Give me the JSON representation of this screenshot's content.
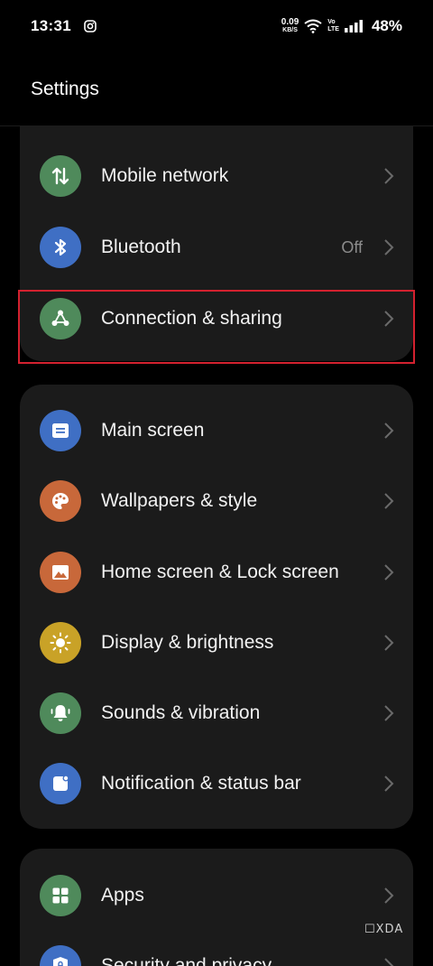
{
  "status_bar": {
    "time": "13:31",
    "speed_value": "0.09",
    "speed_unit": "KB/S",
    "volte_top": "Vo",
    "volte_bottom": "LTE",
    "battery": "48%"
  },
  "header": {
    "title": "Settings"
  },
  "groups": [
    {
      "items": [
        {
          "label": "Mobile network",
          "value": "",
          "icon": "mobile-data-icon",
          "color": "#4f8a5b"
        },
        {
          "label": "Bluetooth",
          "value": "Off",
          "icon": "bluetooth-icon",
          "color": "#3f6fc4"
        },
        {
          "label": "Connection & sharing",
          "value": "",
          "icon": "share-connection-icon",
          "color": "#4f8a5b"
        }
      ]
    },
    {
      "items": [
        {
          "label": "Main screen",
          "value": "",
          "icon": "main-screen-icon",
          "color": "#3f6fc4"
        },
        {
          "label": "Wallpapers & style",
          "value": "",
          "icon": "palette-icon",
          "color": "#c8683a"
        },
        {
          "label": "Home screen & Lock screen",
          "value": "",
          "icon": "image-icon",
          "color": "#c8683a"
        },
        {
          "label": "Display & brightness",
          "value": "",
          "icon": "sun-icon",
          "color": "#c9a227"
        },
        {
          "label": "Sounds & vibration",
          "value": "",
          "icon": "bell-icon",
          "color": "#4f8a5b"
        },
        {
          "label": "Notification & status bar",
          "value": "",
          "icon": "notification-icon",
          "color": "#3f6fc4"
        }
      ]
    },
    {
      "items": [
        {
          "label": "Apps",
          "value": "",
          "icon": "apps-grid-icon",
          "color": "#4f8a5b"
        },
        {
          "label": "Security and privacy",
          "value": "",
          "icon": "shield-lock-icon",
          "color": "#3f6fc4"
        }
      ]
    }
  ],
  "watermark": "☐XDA"
}
